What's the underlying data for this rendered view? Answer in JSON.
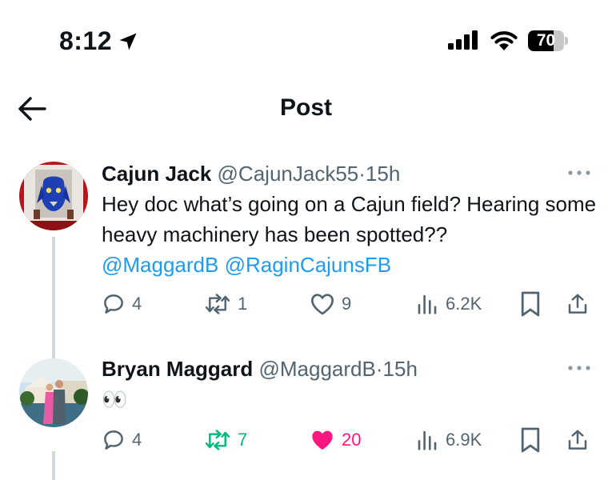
{
  "status_bar": {
    "time": "8:12",
    "battery": "70",
    "battery_level": 0.7
  },
  "header": {
    "title": "Post",
    "back_icon": "arrow-left-icon"
  },
  "tweets": [
    {
      "name": "Cajun Jack",
      "handle": "@CajunJack55",
      "separator": "·",
      "time": "15h",
      "text": "Hey doc what’s going on a Cajun field? Hearing some heavy machinery has been spotted??",
      "mention1": "@MaggardB",
      "mention2": "@RaginCajunsFB",
      "replies": "4",
      "retweets": "1",
      "likes": "9",
      "views": "6.2K"
    },
    {
      "name": "Bryan Maggard",
      "handle": "@MaggardB",
      "separator": "·",
      "time": "15h",
      "text": "👀",
      "replies": "4",
      "retweets": "7",
      "likes": "20",
      "views": "6.9K"
    }
  ],
  "colors": {
    "accent": "#1d9bf0",
    "retweet_active": "#00ba7c",
    "like_active": "#f91880",
    "muted": "#536471",
    "thread_line": "#cfd9de"
  }
}
